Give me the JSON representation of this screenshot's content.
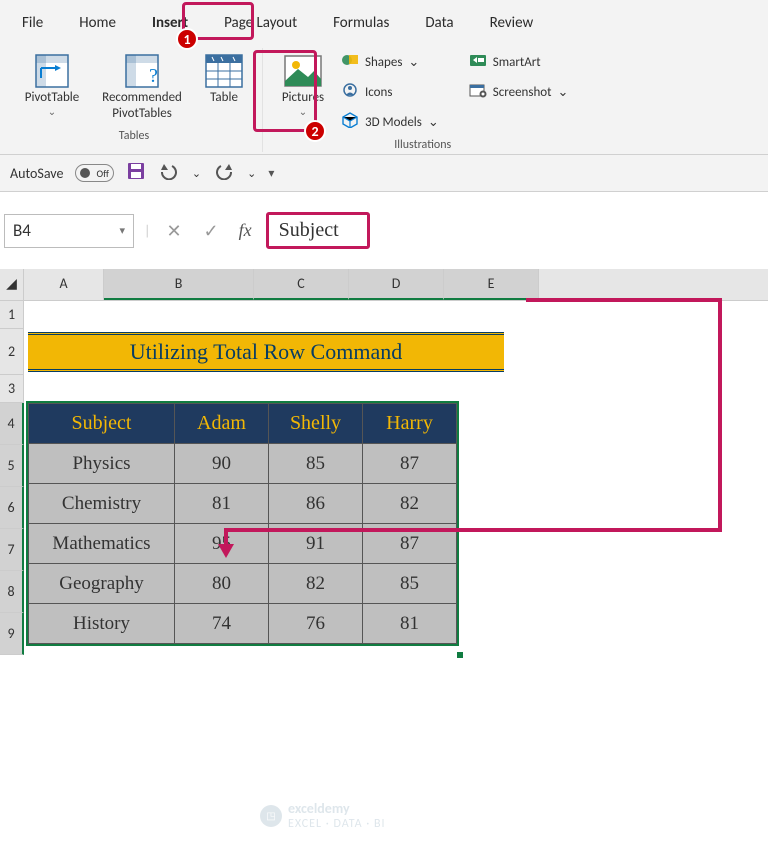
{
  "tabs": [
    "File",
    "Home",
    "Insert",
    "Page Layout",
    "Formulas",
    "Data",
    "Review"
  ],
  "active_tab_index": 2,
  "ribbon": {
    "tables": {
      "label": "Tables",
      "pivot": "PivotTable",
      "recommended": "Recommended PivotTables",
      "table": "Table"
    },
    "illustrations": {
      "label": "Illustrations",
      "pictures": "Pictures",
      "shapes": "Shapes",
      "icons": "Icons",
      "models": "3D Models",
      "smartart": "SmartArt",
      "screenshot": "Screenshot"
    }
  },
  "qat": {
    "autosave_label": "AutoSave",
    "autosave_state": "Off"
  },
  "formula_bar": {
    "cell_ref": "B4",
    "content": "Subject"
  },
  "columns": [
    "A",
    "B",
    "C",
    "D",
    "E"
  ],
  "rows": [
    "1",
    "2",
    "3",
    "4",
    "5",
    "6",
    "7",
    "8",
    "9"
  ],
  "title": "Utilizing Total Row Command",
  "data_table": {
    "headers": [
      "Subject",
      "Adam",
      "Shelly",
      "Harry"
    ],
    "rows": [
      [
        "Physics",
        "90",
        "85",
        "87"
      ],
      [
        "Chemistry",
        "81",
        "86",
        "82"
      ],
      [
        "Mathematics",
        "95",
        "91",
        "87"
      ],
      [
        "Geography",
        "80",
        "82",
        "85"
      ],
      [
        "History",
        "74",
        "76",
        "81"
      ]
    ]
  },
  "callouts": {
    "insert_badge": "1",
    "table_badge": "2"
  },
  "watermark": {
    "name": "exceldemy",
    "tag": "EXCEL · DATA · BI"
  }
}
